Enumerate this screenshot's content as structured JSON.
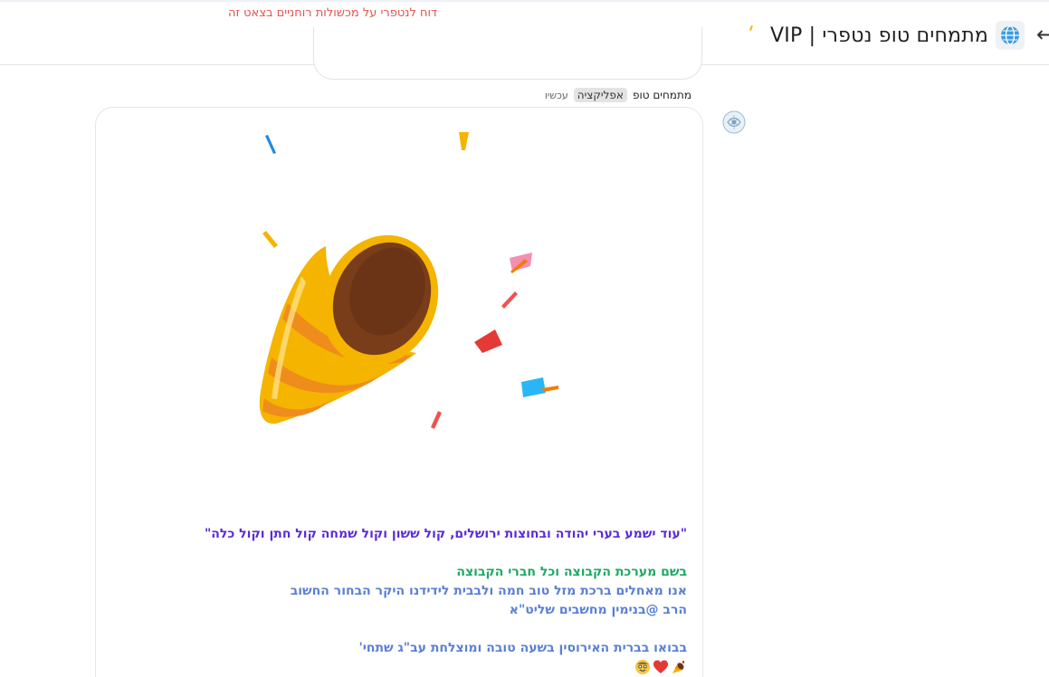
{
  "header": {
    "report_link": "דוח לנטפרי על מכשולות רוחניים בצאט זה",
    "group_title": "מתמחים טופ נטפרי | VIP",
    "globe_icon": "globe-icon",
    "back_icon": "back-arrow-icon",
    "menu_icon": "chevron-down-icon"
  },
  "message": {
    "sender": "מתמחים טופ",
    "app_badge": "אפליקציה",
    "time": "עכשיו",
    "image": "party-popper-icon",
    "quote": "\"עוד ישמע בערי יהודה ובחוצות ירושלים, קול ששון וקול שמחה קול חתן וקול כלה\"",
    "line_green": "בשם מערכת הקבוצה וכל חברי הקבוצה",
    "line_blue_1": "אנו מאחלים ברכת מזל טוב חמה ולבבית לידידנו היקר הבחור החשוב",
    "line_blue_2": "הרב @בנימין מחשבים שליט\"א",
    "line_blue_3": "בבואו בברית האירוסין בשעה טובה ומוצלחת עב\"ג שתחי'",
    "emojis": [
      "party-popper-emoji",
      "red-heart-emoji",
      "smiling-face-emoji"
    ]
  },
  "colors": {
    "report": "#e5534b",
    "quote": "#5b2bd9",
    "green": "#1fa865",
    "blue": "#5a7fd6"
  }
}
